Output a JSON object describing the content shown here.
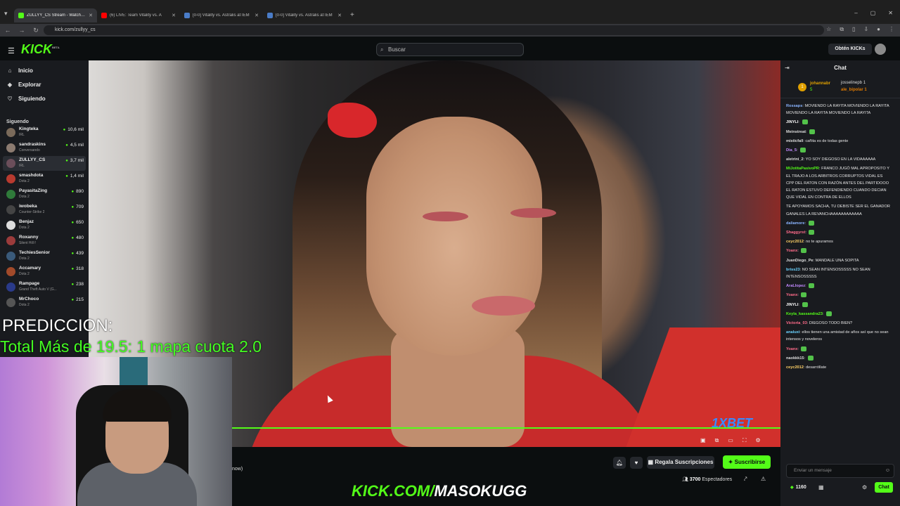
{
  "browser": {
    "tabs": [
      {
        "title": "ZULLYY_CS Stream - Watch Live",
        "active": true,
        "color": "#53fc18"
      },
      {
        "title": "(6) LIVE: Team Vitality vs. A",
        "active": false,
        "color": "#ff0000"
      },
      {
        "title": "[0-0] Vitality vs. Astralis at IEM",
        "active": false,
        "color": "#4a7cc7"
      },
      {
        "title": "[0-0] Vitality vs. Astralis at IEM",
        "active": false,
        "color": "#4a7cc7"
      }
    ],
    "url": "kick.com/zullyy_cs"
  },
  "header": {
    "logo": "KICK",
    "logo_beta": "BETA",
    "search_placeholder": "Buscar",
    "get_kicks_label": "Obtén KICKs"
  },
  "sidebar": {
    "nav": [
      {
        "label": "Inicio",
        "icon": "home-icon"
      },
      {
        "label": "Explorar",
        "icon": "compass-icon"
      },
      {
        "label": "Siguiendo",
        "icon": "heart-icon"
      }
    ],
    "following_title": "Siguendo",
    "channels": [
      {
        "name": "Kingteka",
        "category": "IRL",
        "viewers": "10,6 mil",
        "color": "#7a6a5a"
      },
      {
        "name": "sandraskins",
        "category": "Conversando",
        "viewers": "4,5 mil",
        "color": "#8c7b70"
      },
      {
        "name": "ZULLYY_CS",
        "category": "IRL",
        "viewers": "3,7 mil",
        "color": "#6b4e5a",
        "selected": true
      },
      {
        "name": "smashdota",
        "category": "Dota 2",
        "viewers": "1,4 mil",
        "color": "#b83a2f"
      },
      {
        "name": "PayasitaZing",
        "category": "Dota 2",
        "viewers": "890",
        "color": "#2f7a3a"
      },
      {
        "name": "iwobeka",
        "category": "Counter-Strike 2",
        "viewers": "709",
        "color": "#444"
      },
      {
        "name": "Benjaz",
        "category": "Dota 2",
        "viewers": "650",
        "color": "#ddd"
      },
      {
        "name": "Roxanny",
        "category": "Silent Hill f",
        "viewers": "480",
        "color": "#9b3b3b"
      },
      {
        "name": "TechiesSenior",
        "category": "Dota 2",
        "viewers": "439",
        "color": "#3a5a7a"
      },
      {
        "name": "Accamary",
        "category": "Dota 2",
        "viewers": "318",
        "color": "#a24a2a"
      },
      {
        "name": "Rampage",
        "category": "Grand Theft Auto V (G...",
        "viewers": "238",
        "color": "#2a3a8a"
      },
      {
        "name": "MrChoco",
        "category": "Dota 2",
        "viewers": "215",
        "color": "#555"
      }
    ]
  },
  "overlay": {
    "prediccion_title": "PREDICCION:",
    "prediccion_line": "Total Más de 19.5: 1 mapa cuota 2.0",
    "kick_url_prefix": "KICK.COM/",
    "kick_url_name": "MASOKUGG",
    "sponsor": "1XBET"
  },
  "stream_bar": {
    "now_text": "now)",
    "gift_subs_label": "Regala Suscripciones",
    "subscribe_label": "Suscribirse",
    "viewers_count": "3700",
    "viewers_label": "Espectadores"
  },
  "chat": {
    "title": "Chat",
    "pinned": {
      "badge": "1",
      "user1": "johannabr",
      "user1_count": "5",
      "user2": "josselinepb",
      "user2_count": "1",
      "user3": "ale_bipolar",
      "user3_count": "1"
    },
    "messages": [
      {
        "user": "Rossaps",
        "color": "#8ab4ff",
        "text": "MOVIENDO LA RAYITA MOVIENDO LA RAYITA MOVIENDO LA RAYITA MOVIENDO LA RAYITA"
      },
      {
        "user": "JINYLI",
        "color": "#ffffff",
        "text": ""
      },
      {
        "user": "Meinstreat",
        "color": "#dddddd",
        "text": ""
      },
      {
        "user": "misticfall",
        "color": "#dddddd",
        "text": "cañita es de todas gente"
      },
      {
        "user": "Dia_5",
        "color": "#c38aff",
        "text": ""
      },
      {
        "user": "aletrini_2",
        "color": "#dddddd",
        "text": "YO SOY DIEGOSO EN LA VIDAAAAAA"
      },
      {
        "user": "MiJotitaPasivoPR",
        "color": "#53fc18",
        "text": "FRANCO JUGÓ MAL APROPOSITO Y EL TRAJO A LOS ARBITROS CORRUPTOS VIDAL ES CPP DEL RATON CON RAZÓN ANTES DEL PARTIDOOO EL RATON ESTUVO DEFENDIENDO CUANDO DECIAN QUE VIDAL EN CONTRA DE ELLOS"
      },
      {
        "user": "",
        "color": "#dddddd",
        "text": "TE APOYAMOS SACHA, TU DEBISTE SER EL GANADOR GANALES LA REVANCHAAAAAAAAAAAA"
      },
      {
        "user": "daliamore",
        "color": "#8ab4ff",
        "text": ""
      },
      {
        "user": "Shaggyrst",
        "color": "#ff6b8a",
        "text": ""
      },
      {
        "user": "ceyc2012",
        "color": "#ffd166",
        "text": "no te apuramos"
      },
      {
        "user": "Yoanx",
        "color": "#ff6b8a",
        "text": ""
      },
      {
        "user": "JuanDiego_Pe",
        "color": "#dddddd",
        "text": "MANDALE UNA SOPITA"
      },
      {
        "user": "briss23",
        "color": "#6bd3ff",
        "text": "NO SEAN INTENSOSSSSS NO SEAN INTENSOSSSSS"
      },
      {
        "user": "AraLlopez",
        "color": "#c38aff",
        "text": ""
      },
      {
        "user": "Yoanx",
        "color": "#ff6b8a",
        "text": ""
      },
      {
        "user": "JINYLI",
        "color": "#ffffff",
        "text": ""
      },
      {
        "user": "Keyla_kassandra23",
        "color": "#53fc18",
        "text": ""
      },
      {
        "user": "Victoria_03",
        "color": "#ff6b8a",
        "text": "DIEGOSO TODO BIEN?"
      },
      {
        "user": "analuxi",
        "color": "#6bd3ff",
        "text": "ellos tienen una amistad de años así que no sean intensos y noveleros"
      },
      {
        "user": "Yoanx",
        "color": "#ff6b8a",
        "text": ""
      },
      {
        "user": "naokkk15",
        "color": "#dddddd",
        "text": ""
      },
      {
        "user": "ceyc2012",
        "color": "#ffd166",
        "text": "desarróllate"
      }
    ],
    "input_placeholder": "Enviar un mensaje",
    "coins": "1160",
    "send_label": "Chat"
  }
}
